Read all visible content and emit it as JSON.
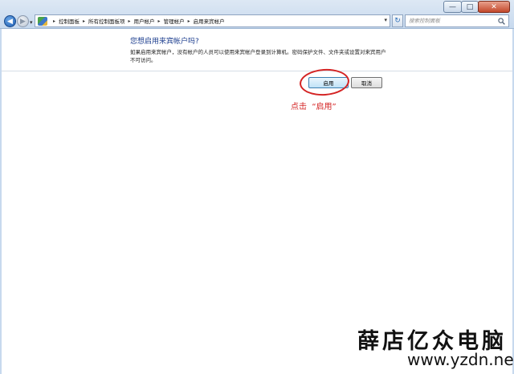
{
  "window": {
    "minimize_glyph": "—",
    "maximize_glyph": "□",
    "close_glyph": "✕"
  },
  "nav": {
    "back_glyph": "◀",
    "forward_glyph": "▶",
    "dropdown_glyph": "▾"
  },
  "address": {
    "breadcrumbs": [
      "控制面板",
      "所有控制面板项",
      "用户帐户",
      "管理帐户",
      "启用来宾帐户"
    ],
    "separator": "▸",
    "dropdown_glyph": "▾",
    "refresh_glyph": "↻",
    "icon": "control-panel-icon"
  },
  "search": {
    "placeholder": "搜索控制面板",
    "icon": "search-icon"
  },
  "content": {
    "heading": "您想启用来宾帐户吗?",
    "description": "如果启用来宾帐户，没有帐户的人员可以使用来宾帐户登录到计算机。密码保护文件、文件夹或设置对来宾用户不可访问。"
  },
  "buttons": {
    "enable_label": "启用",
    "cancel_label": "取消"
  },
  "annotation": {
    "text": "点击  “启用”",
    "color": "#d42424"
  },
  "watermark": {
    "chinese": "薛店亿众电脑",
    "url": "www.yzdn.net"
  },
  "colors": {
    "heading": "#1e3f8f",
    "frame": "#c7d9ee",
    "annotation_red": "#d42424"
  }
}
